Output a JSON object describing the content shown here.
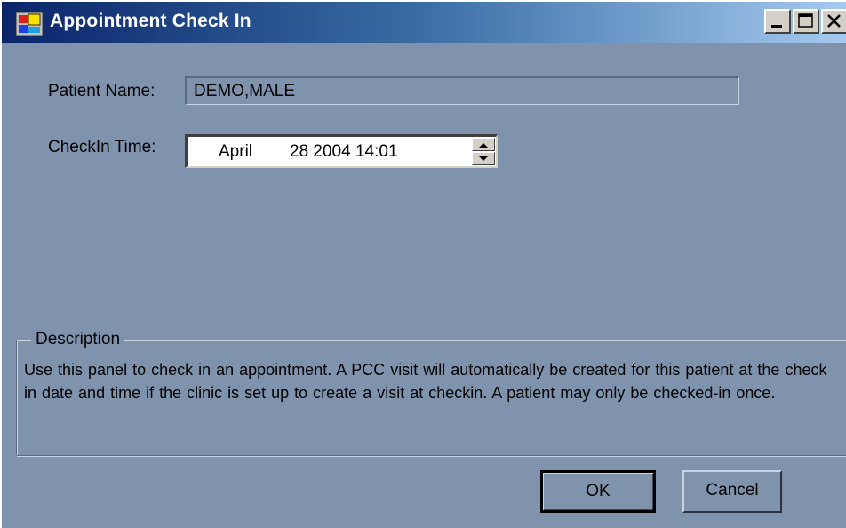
{
  "window": {
    "title": "Appointment Check In",
    "app_icon": "application-icon",
    "controls": {
      "minimize_icon": "minimize-icon",
      "maximize_icon": "maximize-icon",
      "close_icon": "close-icon"
    }
  },
  "form": {
    "patient_name_label": "Patient Name:",
    "patient_name_value": "DEMO,MALE",
    "checkin_time_label": "CheckIn Time:",
    "checkin_month": "April",
    "checkin_rest": "28 2004 14:01"
  },
  "description": {
    "legend": "Description",
    "text": "Use this panel to check in  an appointment. A PCC visit will automatically be created for this patient at the check in date and time if the clinic is set up to create a visit at checkin.  A patient may only be checked-in once."
  },
  "buttons": {
    "ok_label": "OK",
    "cancel_label": "Cancel"
  },
  "colors": {
    "titlebar_start": "#0a246a",
    "titlebar_end": "#a6caf0",
    "window_background": "#7f93ad"
  }
}
